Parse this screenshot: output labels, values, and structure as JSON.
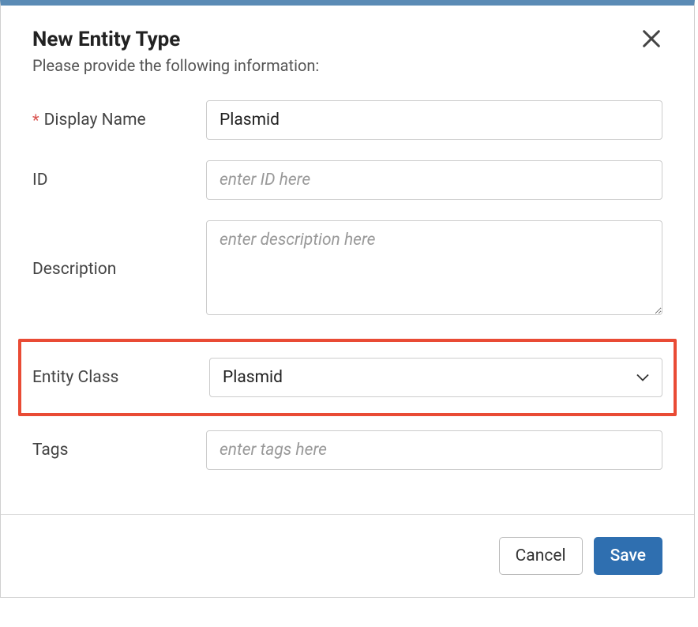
{
  "modal": {
    "title": "New Entity Type",
    "subtitle": "Please provide the following information:"
  },
  "fields": {
    "displayName": {
      "label": "Display Name",
      "value": "Plasmid",
      "required": true
    },
    "id": {
      "label": "ID",
      "value": "",
      "placeholder": "enter ID here"
    },
    "description": {
      "label": "Description",
      "value": "",
      "placeholder": "enter description here"
    },
    "entityClass": {
      "label": "Entity Class",
      "value": "Plasmid"
    },
    "tags": {
      "label": "Tags",
      "value": "",
      "placeholder": "enter tags here"
    }
  },
  "buttons": {
    "cancel": "Cancel",
    "save": "Save"
  },
  "requiredMark": "*"
}
